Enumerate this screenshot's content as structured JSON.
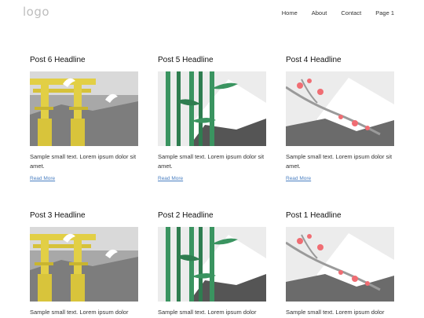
{
  "header": {
    "logo": "logo",
    "nav": [
      "Home",
      "About",
      "Contact",
      "Page 1"
    ]
  },
  "posts": [
    {
      "headline": "Post 6 Headline",
      "image": "torii-gate-icon",
      "excerpt": "Sample small text. Lorem ipsum dolor sit amet.",
      "more": "Read More"
    },
    {
      "headline": "Post 5 Headline",
      "image": "bamboo-icon",
      "excerpt": "Sample small text. Lorem ipsum dolor sit amet.",
      "more": "Read More"
    },
    {
      "headline": "Post 4 Headline",
      "image": "cherry-blossom-icon",
      "excerpt": "Sample small text. Lorem ipsum dolor sit amet.",
      "more": "Read More"
    },
    {
      "headline": "Post 3 Headline",
      "image": "torii-gate-icon",
      "excerpt": "Sample small text. Lorem ipsum dolor",
      "more": ""
    },
    {
      "headline": "Post 2 Headline",
      "image": "bamboo-icon",
      "excerpt": "Sample small text. Lorem ipsum dolor",
      "more": ""
    },
    {
      "headline": "Post 1 Headline",
      "image": "cherry-blossom-icon",
      "excerpt": "Sample small text. Lorem ipsum dolor",
      "more": ""
    }
  ],
  "colors": {
    "link": "#4a7fc1",
    "torii": "#e2cf45",
    "bamboo": "#3a9460",
    "blossom": "#f06d73",
    "mountain": "#6b6b6b"
  }
}
